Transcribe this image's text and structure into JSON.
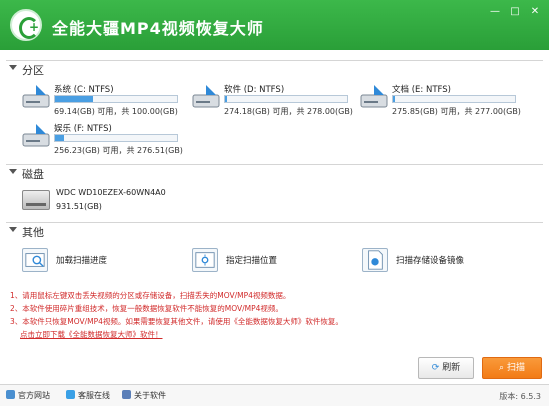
{
  "window": {
    "title": "全能大疆MP4视频恢复大师",
    "min_glyph": "—",
    "max_glyph": "□",
    "close_glyph": "✕",
    "accent": "#2a9f38"
  },
  "sections": {
    "partitions": "分区",
    "disks": "磁盘",
    "others": "其他"
  },
  "partitions": [
    {
      "name": "系统 (C: NTFS)",
      "info": "69.14(GB) 可用，共 100.00(GB)",
      "used_fraction": 0.31
    },
    {
      "name": "软件 (D: NTFS)",
      "info": "274.18(GB) 可用，共 278.00(GB)",
      "used_fraction": 0.01
    },
    {
      "name": "文档 (E: NTFS)",
      "info": "275.85(GB) 可用，共 277.00(GB)",
      "used_fraction": 0.01
    },
    {
      "name": "娱乐 (F: NTFS)",
      "info": "256.23(GB) 可用，共 276.51(GB)",
      "used_fraction": 0.07
    }
  ],
  "disk": {
    "name": "WDC WD10EZEX-60WN4A0",
    "size": "931.51(GB)"
  },
  "tools": [
    {
      "label": "加载扫描进度",
      "icon": "load-progress-icon"
    },
    {
      "label": "指定扫描位置",
      "icon": "target-location-icon"
    },
    {
      "label": "扫描存储设备镜像",
      "icon": "image-file-icon"
    }
  ],
  "notes": {
    "line1": "1、请用鼠标左键双击丢失视频的分区或存储设备，扫描丢失的MOV/MP4视频数据。",
    "line2": "2、本软件使用碎片重组技术，恢复一般数据恢复软件不能恢复的MOV/MP4视频。",
    "line3": "3、本软件只恢复MOV/MP4视频。如果需要恢复其他文件，请使用《全能数据恢复大师》软件恢复。",
    "link": "点击立即下载《全能数据恢复大师》软件！"
  },
  "buttons": {
    "refresh": "刷新",
    "scan": "扫描"
  },
  "statusbar": {
    "website": "官方网站",
    "service": "客服在线",
    "about": "关于软件",
    "version": "版本: 6.5.3"
  }
}
